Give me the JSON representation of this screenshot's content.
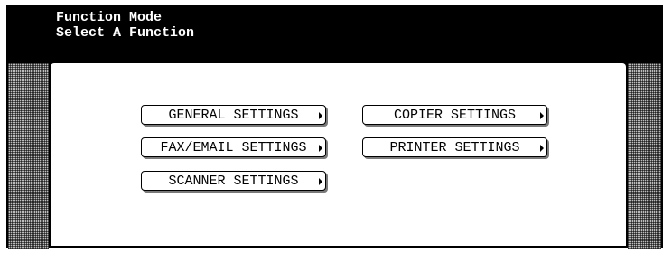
{
  "header": {
    "line1": "Function Mode",
    "line2": "Select A Function"
  },
  "menu": {
    "items": [
      {
        "label": "GENERAL SETTINGS"
      },
      {
        "label": "COPIER SETTINGS"
      },
      {
        "label": "FAX/EMAIL SETTINGS"
      },
      {
        "label": "PRINTER SETTINGS"
      },
      {
        "label": "SCANNER SETTINGS"
      }
    ]
  },
  "icons": {
    "button_arrow": "chevron-right-icon"
  },
  "colors": {
    "header_background": "#000000",
    "header_text": "#ffffff",
    "content_background": "#ffffff",
    "side_panel_pattern": "#bdbdbd"
  }
}
